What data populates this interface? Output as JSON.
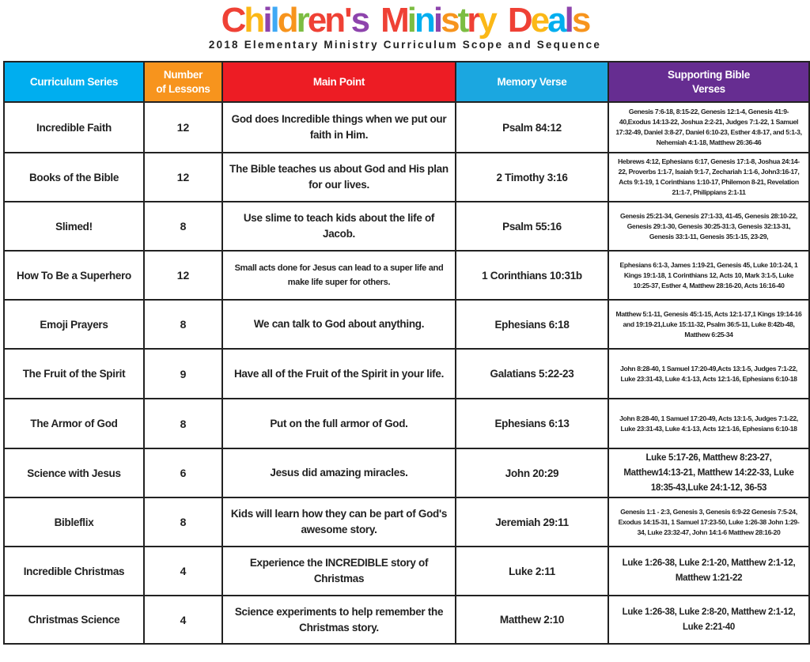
{
  "header": {
    "logo_text": "Children's Ministry Deals",
    "logo_letters": [
      {
        "ch": "C",
        "color": "#ef4135"
      },
      {
        "ch": "h",
        "color": "#fbb817"
      },
      {
        "ch": "i",
        "color": "#8e44ad"
      },
      {
        "ch": "l",
        "color": "#3fa9f5"
      },
      {
        "ch": "d",
        "color": "#f7941d"
      },
      {
        "ch": "r",
        "color": "#7cbd42"
      },
      {
        "ch": "e",
        "color": "#ef4135"
      },
      {
        "ch": "n",
        "color": "#ef4135"
      },
      {
        "ch": "'",
        "color": "#ef4135"
      },
      {
        "ch": "s",
        "color": "#8e44ad"
      },
      {
        "ch": " ",
        "color": "#ffffff"
      },
      {
        "ch": "M",
        "color": "#ef4135"
      },
      {
        "ch": "i",
        "color": "#7cbd42"
      },
      {
        "ch": "n",
        "color": "#00aeef"
      },
      {
        "ch": "i",
        "color": "#8e44ad"
      },
      {
        "ch": "s",
        "color": "#f7941d"
      },
      {
        "ch": "t",
        "color": "#7cbd42"
      },
      {
        "ch": "r",
        "color": "#ef4135"
      },
      {
        "ch": "y",
        "color": "#fbb817"
      },
      {
        "ch": " ",
        "color": "#ffffff"
      },
      {
        "ch": "D",
        "color": "#ef4135"
      },
      {
        "ch": "e",
        "color": "#fbb817"
      },
      {
        "ch": "a",
        "color": "#00aeef"
      },
      {
        "ch": "l",
        "color": "#8e44ad"
      },
      {
        "ch": "s",
        "color": "#f7941d"
      }
    ],
    "subtitle": "2018 Elementary Ministry Curriculum Scope and Sequence"
  },
  "table": {
    "columns": [
      {
        "label": "Curriculum Series",
        "color": "#00aeef"
      },
      {
        "label": "Number of Lessons",
        "line1": "Number",
        "line2": "of Lessons",
        "color": "#f7941d"
      },
      {
        "label": "Main Point",
        "color": "#ed1c24"
      },
      {
        "label": "Memory Verse",
        "color": "#1ba7e0"
      },
      {
        "label": "Supporting Bible Verses",
        "line1": "Supporting Bible",
        "line2": "Verses",
        "color": "#662d91"
      }
    ],
    "rows": [
      {
        "series": "Incredible Faith",
        "lessons": "12",
        "main_point": "God does Incredible things when we put our faith in Him.",
        "memory_verse": "Psalm 84:12",
        "supporting": "Genesis 7:6-18, 8:15-22, Genesis 12:1-4, Genesis 41:9-40,Exodus 14:13-22, Joshua 2:2-21, Judges 7:1-22, 1 Samuel 17:32-49, Daniel 3:8-27, Daniel 6:10-23, Esther 4:8-17, and 5:1-3, Nehemiah 4:1-18, Matthew 26:36-46"
      },
      {
        "series": "Books of  the Bible",
        "lessons": "12",
        "main_point": "The Bible teaches us about God and His plan for our lives.",
        "memory_verse": "2 Timothy 3:16",
        "supporting": "Hebrews 4:12, Ephesians 6:17, Genesis 17:1-8, Joshua 24:14-22, Proverbs 1:1-7, Isaiah 9:1-7, Zechariah 1:1-6, John3:16-17, Acts 9:1-19, 1 Corinthians 1:10-17, Philemon 8-21, Revelation 21:1-7, Philippians 2:1-11"
      },
      {
        "series": "Slimed!",
        "lessons": "8",
        "main_point": "Use slime to teach kids about the life of Jacob.",
        "memory_verse": "Psalm 55:16",
        "supporting": "Genesis 25:21-34, Genesis 27:1-33, 41-45, Genesis 28:10-22, Genesis 29:1-30, Genesis 30:25-31:3, Genesis 32:13-31, Genesis 33:1-11, Genesis 35:1-15, 23-29,"
      },
      {
        "series": "How To Be a Superhero",
        "lessons": "12",
        "main_point": "Small acts done for Jesus can lead to a super life and make life super for others.",
        "memory_verse": "1 Corinthians 10:31b",
        "supporting": "Ephesians 6:1-3, James 1:19-21, Genesis 45, Luke 10:1-24, 1 Kings 19:1-18, 1 Corinthians 12, Acts 10, Mark 3:1-5, Luke 10:25-37, Esther 4, Matthew 28:16-20, Acts 16:16-40"
      },
      {
        "series": "Emoji Prayers",
        "lessons": "8",
        "main_point": "We can talk to God about anything.",
        "memory_verse": "Ephesians 6:18",
        "supporting": "Matthew 5:1-11, Genesis 45:1-15, Acts 12:1-17,1 Kings 19:14-16 and 19:19-21,Luke 15:11-32, Psalm 36:5-11, Luke 8:42b-48, Matthew 6:25-34"
      },
      {
        "series": "The Fruit of the Spirit",
        "lessons": "9",
        "main_point": "Have all of the Fruit of the Spirit in your life.",
        "memory_verse": "Galatians 5:22-23",
        "supporting": "John 8:28-40, 1 Samuel 17:20-49,Acts 13:1-5, Judges 7:1-22, Luke 23:31-43, Luke 4:1-13, Acts 12:1-16, Ephesians 6:10-18"
      },
      {
        "series": "The Armor of God",
        "lessons": "8",
        "main_point": "Put on the full armor of God.",
        "memory_verse": "Ephesians 6:13",
        "supporting": "John 8:28-40, 1 Samuel 17:20-49, Acts 13:1-5, Judges 7:1-22, Luke 23:31-43, Luke 4:1-13, Acts 12:1-16, Ephesians 6:10-18"
      },
      {
        "series": "Science with Jesus",
        "lessons": "6",
        "main_point": "Jesus did amazing miracles.",
        "memory_verse": "John 20:29",
        "supporting": "Luke 5:17-26, Matthew 8:23-27, Matthew14:13-21, Matthew 14:22-33, Luke 18:35-43,Luke 24:1-12, 36-53"
      },
      {
        "series": "Bibleflix",
        "lessons": "8",
        "main_point": "Kids will learn how they can be part of God's awesome story.",
        "memory_verse": "Jeremiah 29:11",
        "supporting": "Genesis 1:1 - 2:3, Genesis 3, Genesis 6:9-22 Genesis 7:5-24, Exodus 14:15-31, 1 Samuel 17:23-50, Luke 1:26-38 John 1:29-34, Luke 23:32-47, John 14:1-6 Matthew 28:16-20"
      },
      {
        "series": "Incredible Christmas",
        "lessons": "4",
        "main_point": "Experience the INCREDIBLE story of Christmas",
        "memory_verse": "Luke 2:11",
        "supporting": "Luke 1:26-38,  Luke 2:1-20, Matthew 2:1-12, Matthew 1:21-22"
      },
      {
        "series": "Christmas Science",
        "lessons": "4",
        "main_point": "Science experiments to help remember the Christmas story.",
        "memory_verse": "Matthew 2:10",
        "supporting": "Luke 1:26-38, Luke 2:8-20, Matthew 2:1-12, Luke 2:21-40"
      }
    ]
  }
}
